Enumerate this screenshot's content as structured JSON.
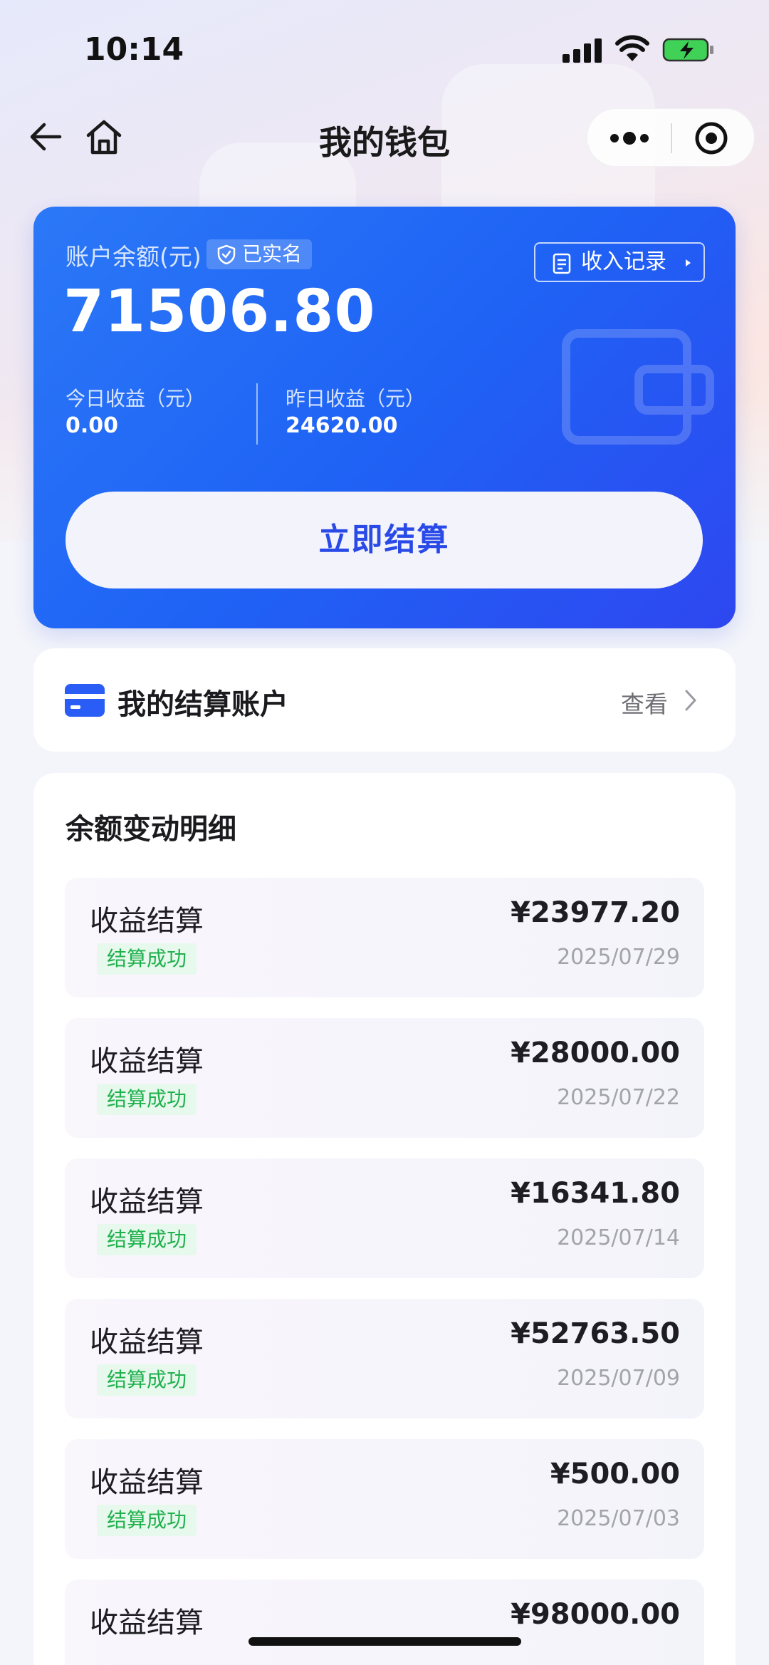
{
  "status_bar": {
    "time": "10:14"
  },
  "nav": {
    "title": "我的钱包"
  },
  "balance_card": {
    "label": "账户余额(元)",
    "verified_label": "已实名",
    "income_record_label": "收入记录",
    "balance": "71506.80",
    "today_label": "今日收益（元）",
    "today_value": "0.00",
    "yesterday_label": "昨日收益（元）",
    "yesterday_value": "24620.00",
    "settle_button": "立即结算"
  },
  "account": {
    "title": "我的结算账户",
    "view_label": "查看"
  },
  "detail": {
    "title": "余额变动明细",
    "items": [
      {
        "title": "收益结算",
        "status": "结算成功",
        "amount": "¥23977.20",
        "date": "2025/07/29"
      },
      {
        "title": "收益结算",
        "status": "结算成功",
        "amount": "¥28000.00",
        "date": "2025/07/22"
      },
      {
        "title": "收益结算",
        "status": "结算成功",
        "amount": "¥16341.80",
        "date": "2025/07/14"
      },
      {
        "title": "收益结算",
        "status": "结算成功",
        "amount": "¥52763.50",
        "date": "2025/07/09"
      },
      {
        "title": "收益结算",
        "status": "结算成功",
        "amount": "¥500.00",
        "date": "2025/07/03"
      },
      {
        "title": "收益结算",
        "amount": "¥98000.00"
      }
    ]
  },
  "colors": {
    "primary": "#2363f5",
    "success": "#1fb14d",
    "success_bg": "#e7f8ec"
  },
  "icons": [
    "back-icon",
    "home-icon",
    "more-icon",
    "target-icon",
    "shield-icon",
    "doc-icon",
    "wallet-icon",
    "card-icon",
    "chevron-right-icon"
  ]
}
